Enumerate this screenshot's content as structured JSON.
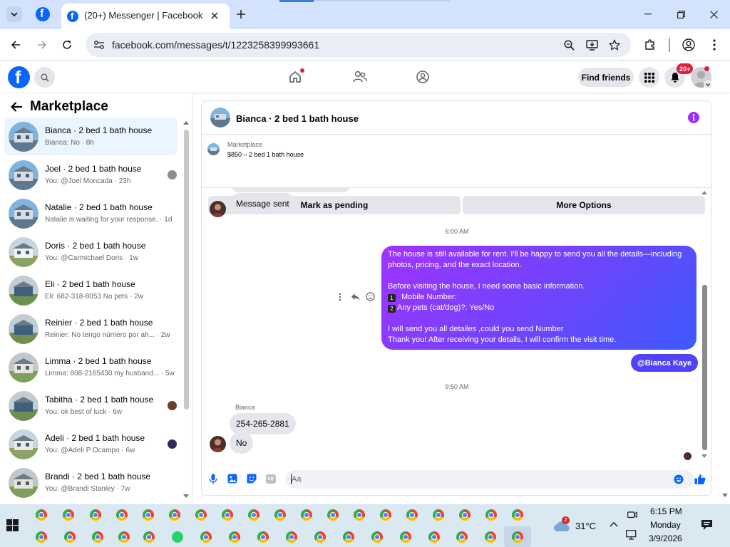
{
  "browser": {
    "tab_title": "(20+) Messenger | Facebook",
    "url": "facebook.com/messages/t/1223258399993661"
  },
  "header": {
    "find_friends": "Find friends",
    "notification_count": "20+"
  },
  "sidebar": {
    "title": "Marketplace",
    "conversations": [
      {
        "title": "Bianca · 2 bed 1 bath house",
        "sub": "Bianca: No · 8h"
      },
      {
        "title": "Joel · 2 bed 1 bath house",
        "sub": "You: @Joel Moncada · 23h"
      },
      {
        "title": "Natalie · 2 bed 1 bath house",
        "sub": "Natalie is waiting for your response. · 1d"
      },
      {
        "title": "Doris · 2 bed 1 bath house",
        "sub": "You: @Carmichael Doris · 1w"
      },
      {
        "title": "Eli · 2 bed 1 bath house",
        "sub": "Eli: 682-318-8053 No pets · 2w"
      },
      {
        "title": "Reinier · 2 bed 1 bath house",
        "sub": "Reinier: No tengo número por ah... · 2w"
      },
      {
        "title": "Limma · 2 bed 1 bath house",
        "sub": "Limma: 808-2165430 my husband... · 5w"
      },
      {
        "title": "Tabitha · 2 bed 1 bath house",
        "sub": "You: ok best of luck · 6w"
      },
      {
        "title": "Adeli · 2 bed 1 bath house",
        "sub": "You: @Adeli P Ocampo · 6w"
      },
      {
        "title": "Brandi · 2 bed 1 bath house",
        "sub": "You: @Brandi Stanley · 7w"
      }
    ]
  },
  "chat": {
    "title": "Bianca · 2 bed 1 bath house",
    "listing_label": "Marketplace",
    "listing_price": "$850 – 2 bed 1 bath house",
    "mark_pending": "Mark as pending",
    "more_options": "More Options",
    "msg_sent": "Message sent",
    "time1": "6:00 AM",
    "outgoing": {
      "l1": "The house is still available for rent. I'll be happy to send you all the details—including",
      "l2": "photos, pricing, and the exact location.",
      "l3": "Before visiting the house, I need some basic information.",
      "l4": "Mobile Number:",
      "l5": "Any pets (cat/dog)?: Yes/No",
      "l6": "I will send you all detailes ,could you send Number",
      "l7": "Thank you! After receiving your details, I will confirm the visit time.",
      "n1": "1",
      "n2": "2"
    },
    "mention": "@Bianca Kaye",
    "time2": "9:50 AM",
    "sender": "Bianca",
    "reply1": "254-265-2881",
    "reply2": "No",
    "input_placeholder": "Aa"
  },
  "taskbar": {
    "weather_badge": "2",
    "temperature": "31°C",
    "time": "6:15 PM",
    "day": "Monday",
    "date": "3/9/2026"
  },
  "colors": {
    "fb_blue": "#0866ff",
    "bubble_gradient_start": "#a033ff",
    "bubble_gradient_end": "#3d5afe",
    "notification_red": "#e41e3f"
  }
}
